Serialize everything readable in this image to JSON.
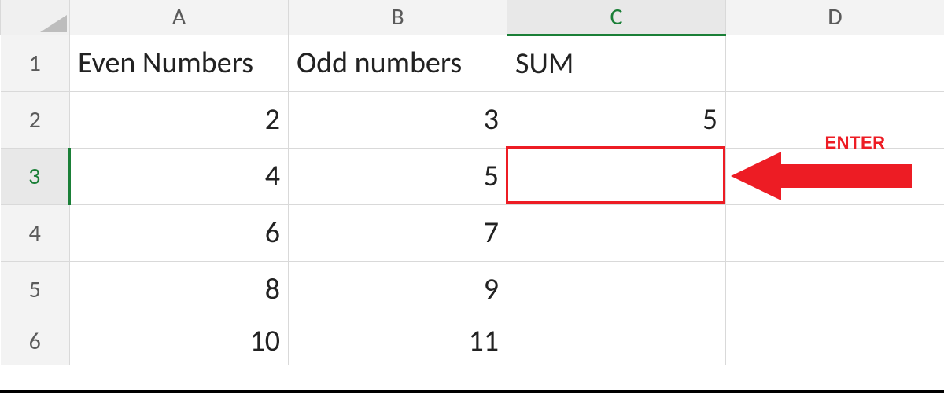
{
  "columns": [
    "A",
    "B",
    "C",
    "D"
  ],
  "row_numbers": [
    "1",
    "2",
    "3",
    "4",
    "5",
    "6"
  ],
  "selected_column_index": 2,
  "selected_row_index": 2,
  "headers_row": {
    "A": "Even Numbers",
    "B": "Odd numbers",
    "C": "SUM",
    "D": ""
  },
  "rows": [
    {
      "A": "2",
      "B": "3",
      "C": "5",
      "D": ""
    },
    {
      "A": "4",
      "B": "5",
      "C": "",
      "D": ""
    },
    {
      "A": "6",
      "B": "7",
      "C": "",
      "D": ""
    },
    {
      "A": "8",
      "B": "9",
      "C": "",
      "D": ""
    },
    {
      "A": "10",
      "B": "11",
      "C": "",
      "D": ""
    }
  ],
  "annotation": {
    "label": "ENTER",
    "color": "#ed1c24",
    "points_to": "C3"
  },
  "selected_cell": "C3",
  "chart_data": {
    "type": "table",
    "columns": [
      "Even Numbers",
      "Odd numbers",
      "SUM"
    ],
    "rows": [
      [
        2,
        3,
        5
      ],
      [
        4,
        5,
        null
      ],
      [
        6,
        7,
        null
      ],
      [
        8,
        9,
        null
      ],
      [
        10,
        11,
        null
      ]
    ]
  }
}
